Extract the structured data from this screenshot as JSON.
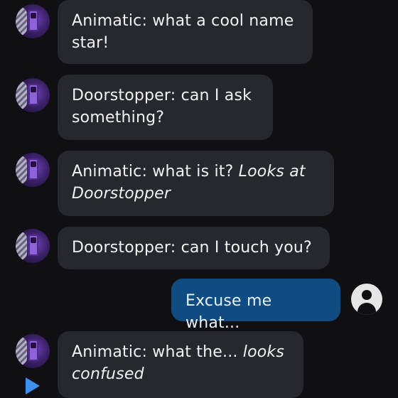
{
  "messages": [
    {
      "speaker": "Animatic",
      "line1": "Animatic: what a cool name",
      "line2": "star!",
      "action": ""
    },
    {
      "speaker": "Doorstopper",
      "line1": "Doorstopper: can I ask",
      "line2": "something?",
      "action": ""
    },
    {
      "speaker": "Animatic",
      "line1": "Animatic: what is it? ",
      "line1_action": "Looks at",
      "line2": "Doorstopper"
    },
    {
      "speaker": "Doorstopper",
      "line1": "Doorstopper: can I touch you?"
    },
    {
      "speaker": "user",
      "text": "Excuse me what..."
    },
    {
      "speaker": "Animatic",
      "line1": "Animatic: what the... ",
      "line1_action": "looks",
      "line2": "confused"
    }
  ],
  "icons": {
    "user": "user-avatar-icon",
    "play": "play-icon"
  },
  "colors": {
    "background": "#101014",
    "bot_bubble": "#26282d",
    "user_bubble": "#0f4c81",
    "accent": "#3d8ff0"
  }
}
